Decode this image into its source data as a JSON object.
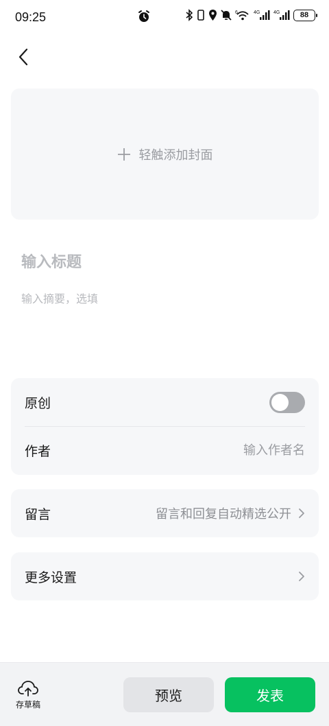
{
  "status_bar": {
    "time": "09:25",
    "battery": "88",
    "network_1": "4G",
    "network_2": "4G",
    "wifi_badge": "6"
  },
  "header": {
    "back_icon": "chevron-left-icon"
  },
  "cover": {
    "plus_icon": "plus-icon",
    "label": "轻触添加封面"
  },
  "editor": {
    "title_placeholder": "输入标题",
    "summary_placeholder": "输入摘要，选填"
  },
  "settings_card": {
    "original_label": "原创",
    "original_enabled": false,
    "author_label": "作者",
    "author_placeholder": "输入作者名"
  },
  "comments_card": {
    "label": "留言",
    "value": "留言和回复自动精选公开"
  },
  "more_card": {
    "label": "更多设置"
  },
  "bottom_bar": {
    "draft_icon": "cloud-upload-icon",
    "draft_label": "存草稿",
    "preview_label": "预览",
    "publish_label": "发表"
  },
  "colors": {
    "accent": "#07c160",
    "card_bg": "#f6f7f9",
    "toggle_off": "#a9abaf"
  }
}
